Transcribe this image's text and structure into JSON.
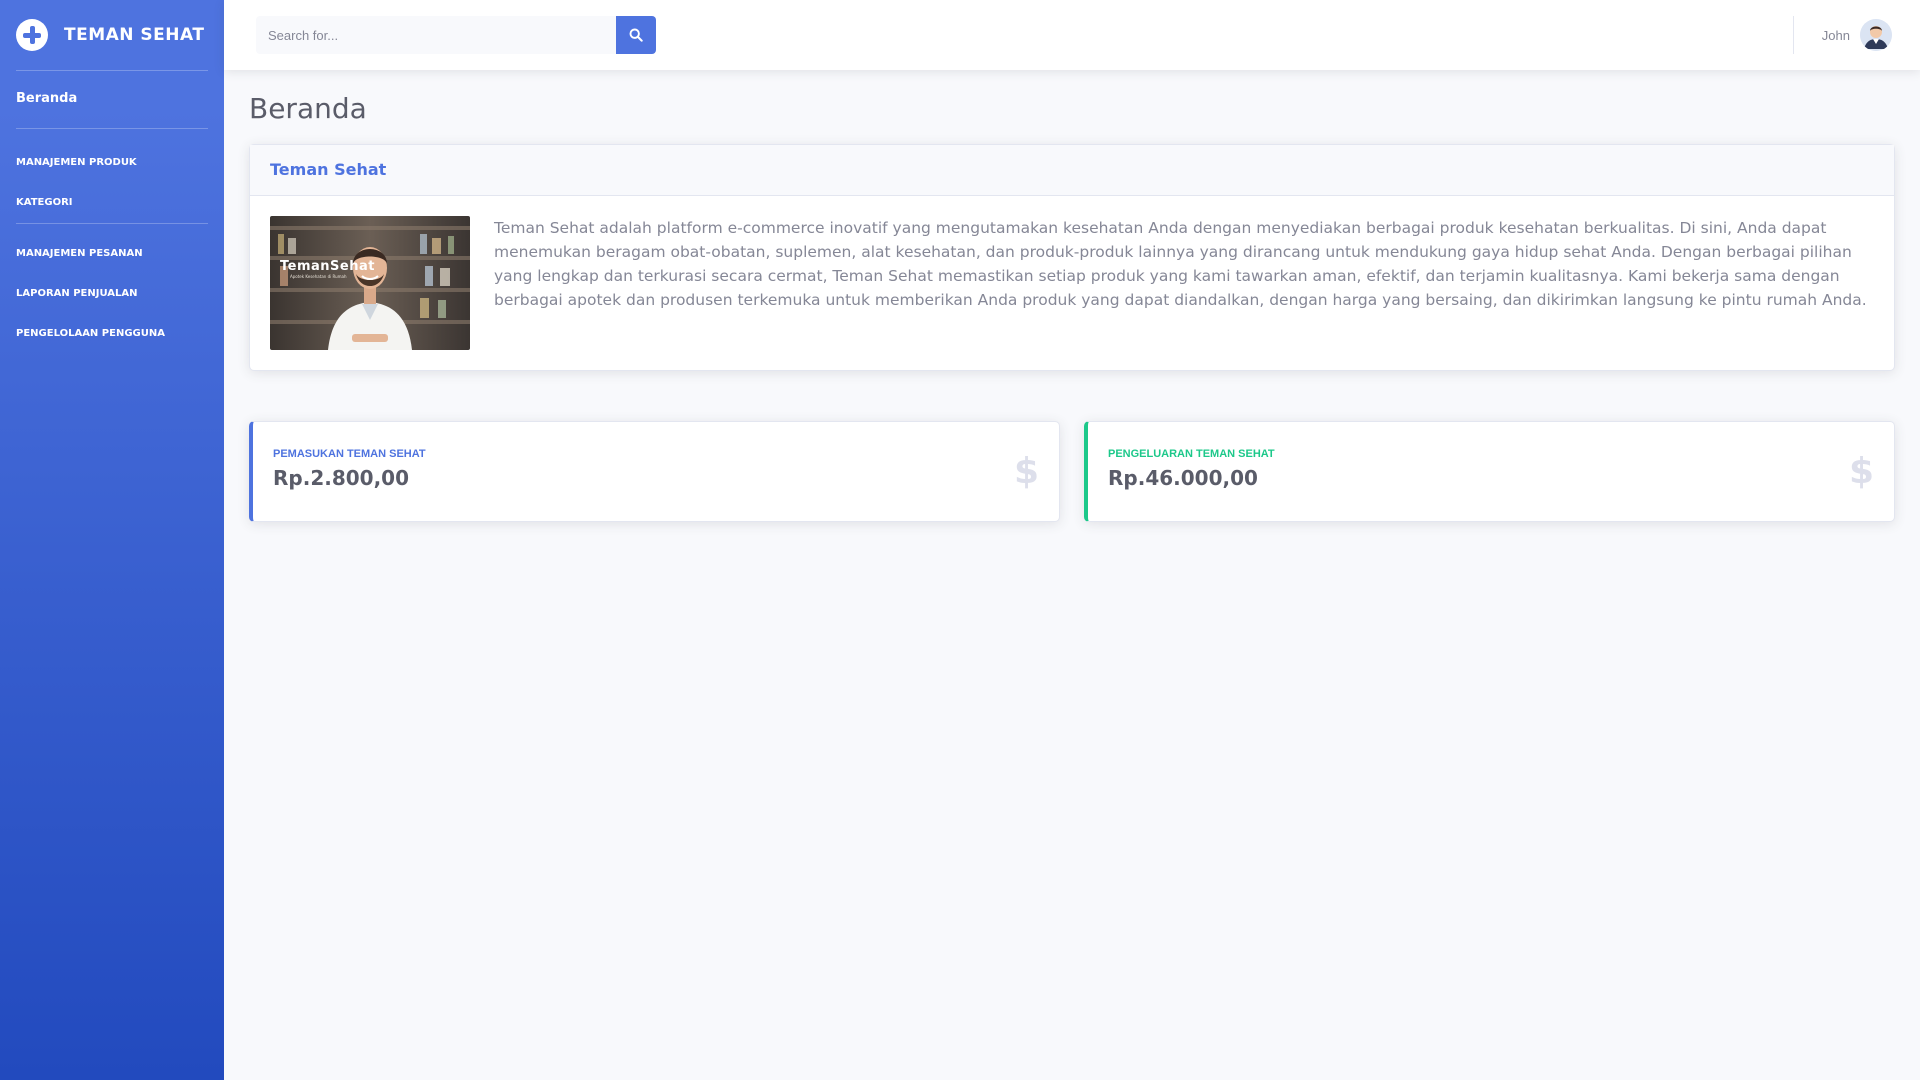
{
  "brand": {
    "name": "TEMAN SEHAT",
    "icon": "plus-circle-icon"
  },
  "sidebar": {
    "home": "Beranda",
    "items": [
      {
        "label": "MANAJEMEN PRODUK"
      },
      {
        "label": "KATEGORI"
      },
      {
        "label": "MANAJEMEN PESANAN"
      },
      {
        "label": "LAPORAN PENJUALAN"
      },
      {
        "label": "PENGELOLAAN PENGGUNA"
      }
    ]
  },
  "topbar": {
    "search_placeholder": "Search for...",
    "search_icon": "search-icon",
    "user_name": "John"
  },
  "page": {
    "title": "Beranda"
  },
  "about_card": {
    "title": "Teman Sehat",
    "image_caption": "TemanSehat",
    "image_subcaption": "Apotek Kesehatan di Rumah",
    "text": "Teman Sehat adalah platform e-commerce inovatif yang mengutamakan kesehatan Anda dengan menyediakan berbagai produk kesehatan berkualitas. Di sini, Anda dapat menemukan beragam obat-obatan, suplemen, alat kesehatan, dan produk-produk lainnya yang dirancang untuk mendukung gaya hidup sehat Anda. Dengan berbagai pilihan yang lengkap dan terkurasi secara cermat, Teman Sehat memastikan setiap produk yang kami tawarkan aman, efektif, dan terjamin kualitasnya. Kami bekerja sama dengan berbagai apotek dan produsen terkemuka untuk memberikan Anda produk yang dapat diandalkan, dengan harga yang bersaing, dan dikirimkan langsung ke pintu rumah Anda."
  },
  "stats": [
    {
      "label": "PEMASUKAN TEMAN SEHAT",
      "value": "Rp.2.800,00",
      "color": "#4e73df",
      "icon": "dollar-icon",
      "icon_glyph": "$"
    },
    {
      "label": "PENGELUARAN TEMAN SEHAT",
      "value": "Rp.46.000,00",
      "color": "#1cc88a",
      "icon": "dollar-icon",
      "icon_glyph": "$"
    }
  ],
  "colors": {
    "primary": "#4e73df",
    "success": "#1cc88a",
    "text": "#858796",
    "heading": "#5a5c69"
  }
}
